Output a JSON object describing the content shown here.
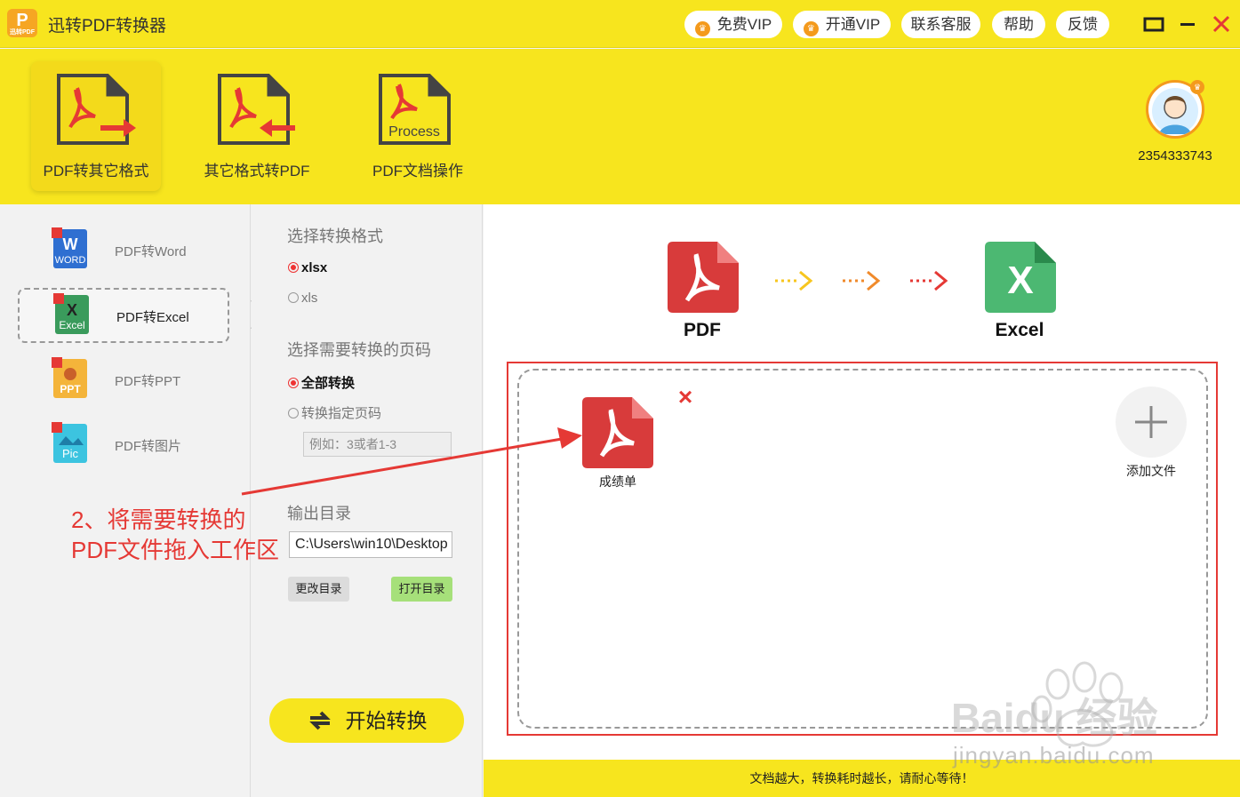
{
  "app": {
    "title": "迅转PDF转换器",
    "logo_letter": "P",
    "logo_sub": "迅转PDF"
  },
  "titlebar": {
    "free_vip": "免费VIP",
    "open_vip": "开通VIP",
    "contact": "联系客服",
    "help": "帮助",
    "feedback": "反馈"
  },
  "toolbar": {
    "tools": [
      {
        "label": "PDF转其它格式"
      },
      {
        "label": "其它格式转PDF"
      },
      {
        "label": "PDF文档操作",
        "icon_text": "Process"
      }
    ]
  },
  "user": {
    "id": "2354333743"
  },
  "sidebar": {
    "items": [
      {
        "label": "PDF转Word",
        "icon_text": "WORD"
      },
      {
        "label": "PDF转Excel",
        "icon_text": "Excel"
      },
      {
        "label": "PDF转PPT",
        "icon_text": "PPT"
      },
      {
        "label": "PDF转图片",
        "icon_text": "Pic"
      }
    ]
  },
  "options": {
    "format_heading": "选择转换格式",
    "format_options": [
      "xlsx",
      "xls"
    ],
    "format_selected": "xlsx",
    "pages_heading": "选择需要转换的页码",
    "page_options": [
      "全部转换",
      "转换指定页码"
    ],
    "page_selected": "全部转换",
    "page_placeholder": "例如：3或者1-3",
    "output_heading": "输出目录",
    "output_dir": "C:\\Users\\win10\\Desktop",
    "change_dir": "更改目录",
    "open_dir": "打开目录",
    "start": "开始转换"
  },
  "main": {
    "from_label": "PDF",
    "to_label": "Excel",
    "to_icon_letter": "X",
    "files": [
      {
        "name": "成绩单"
      }
    ],
    "add_label": "添加文件",
    "footer": "文档越大，转换耗时越长，请耐心等待！"
  },
  "annotation": {
    "line1": "2、将需要转换的",
    "line2": "PDF文件拖入工作区"
  },
  "watermark": {
    "brand": "Baidu 经验",
    "url": "jingyan.baidu.com"
  },
  "colors": {
    "brand_yellow": "#f7e51e",
    "accent_red": "#e53935",
    "vip_orange": "#f49a1c",
    "excel_green": "#2e9e5b"
  }
}
